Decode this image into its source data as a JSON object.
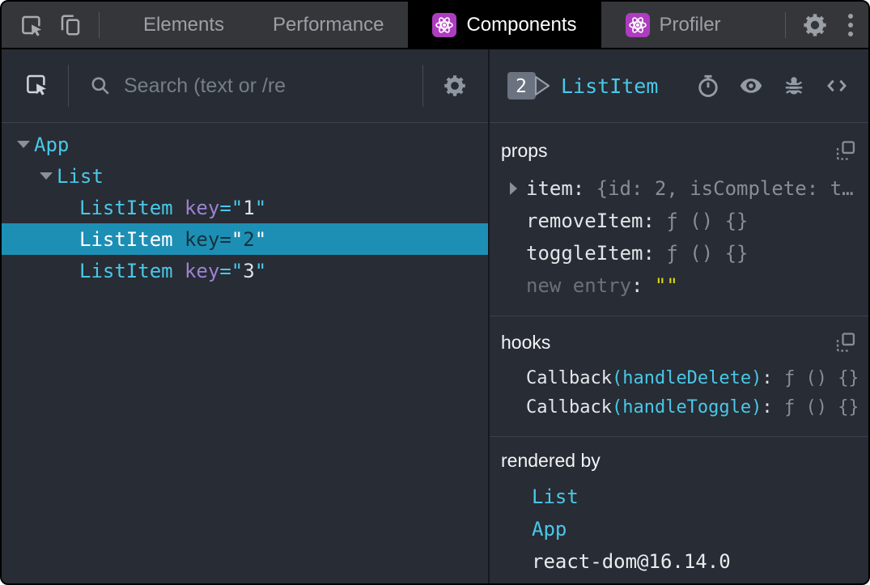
{
  "topbar": {
    "tabs": [
      {
        "label": "Elements"
      },
      {
        "label": "Performance"
      },
      {
        "label": "Components"
      },
      {
        "label": "Profiler"
      }
    ],
    "active_tab": "Components"
  },
  "left_panel": {
    "search": {
      "placeholder": "Search (text or /re"
    },
    "tree": [
      {
        "name": "App",
        "depth": 0,
        "expanded": true
      },
      {
        "name": "List",
        "depth": 1,
        "expanded": true
      },
      {
        "name": "ListItem",
        "depth": 2,
        "key_attr": "key",
        "key_value": "1"
      },
      {
        "name": "ListItem",
        "depth": 2,
        "key_attr": "key",
        "key_value": "2",
        "selected": true
      },
      {
        "name": "ListItem",
        "depth": 2,
        "key_attr": "key",
        "key_value": "3"
      }
    ]
  },
  "right_panel": {
    "badge": "2",
    "title": "ListItem",
    "props": {
      "label": "props",
      "rows": [
        {
          "name": "item",
          "value": "{id: 2, isComplete: t…",
          "expandable": true
        },
        {
          "name": "removeItem",
          "value": "ƒ () {}"
        },
        {
          "name": "toggleItem",
          "value": "ƒ () {}"
        },
        {
          "name": "new entry",
          "value": "\"\"",
          "editable_placeholder": true
        }
      ]
    },
    "hooks": {
      "label": "hooks",
      "rows": [
        {
          "name": "Callback",
          "fn": "(handleDelete)",
          "value": "ƒ () {}"
        },
        {
          "name": "Callback",
          "fn": "(handleToggle)",
          "value": "ƒ () {}"
        }
      ]
    },
    "rendered_by": {
      "label": "rendered by",
      "items": [
        "List",
        "App",
        "react-dom@16.14.0"
      ]
    }
  },
  "syntax": {
    "eq": "=",
    "quote": "\"",
    "colon": ":"
  },
  "colors": {
    "panel_bg": "#282c34",
    "topbar_bg": "#35363a",
    "accent_cyan": "#49c8e9",
    "key_purple": "#9d82d3",
    "selected_row_bg": "#1d8fb5",
    "react_logo_purple": "#ae3cc0",
    "value_yellow": "#dedb10",
    "value_gray": "#878e98",
    "active_tab_bg": "#000000"
  }
}
